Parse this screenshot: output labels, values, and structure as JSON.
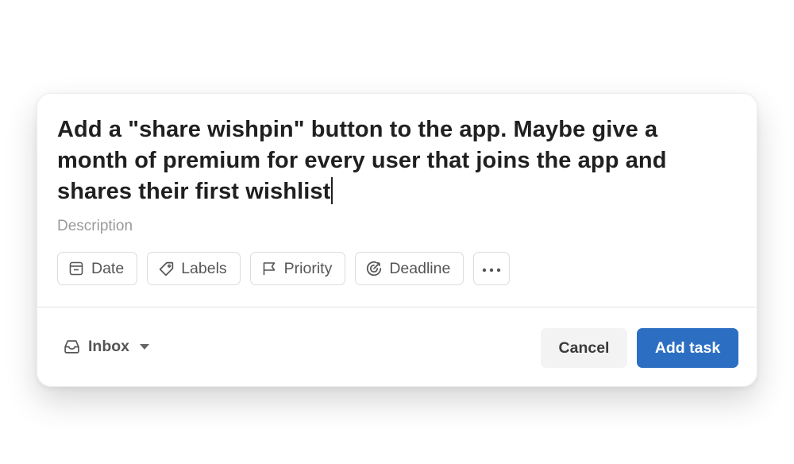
{
  "task": {
    "title": "Add a \"share wishpin\" button to the app. Maybe give a month of premium for every user that joins the app and shares their first wishlist",
    "description_placeholder": "Description"
  },
  "chips": {
    "date": {
      "label": "Date",
      "icon": "calendar-icon"
    },
    "labels": {
      "label": "Labels",
      "icon": "tag-icon"
    },
    "priority": {
      "label": "Priority",
      "icon": "flag-icon"
    },
    "deadline": {
      "label": "Deadline",
      "icon": "target-icon"
    },
    "more": {
      "icon": "more-horizontal-icon"
    }
  },
  "footer": {
    "project": {
      "label": "Inbox",
      "icon": "inbox-icon"
    },
    "cancel_label": "Cancel",
    "add_label": "Add task"
  },
  "colors": {
    "accent": "#2c6fc2",
    "text": "#202020",
    "muted": "#9a9a9a"
  }
}
